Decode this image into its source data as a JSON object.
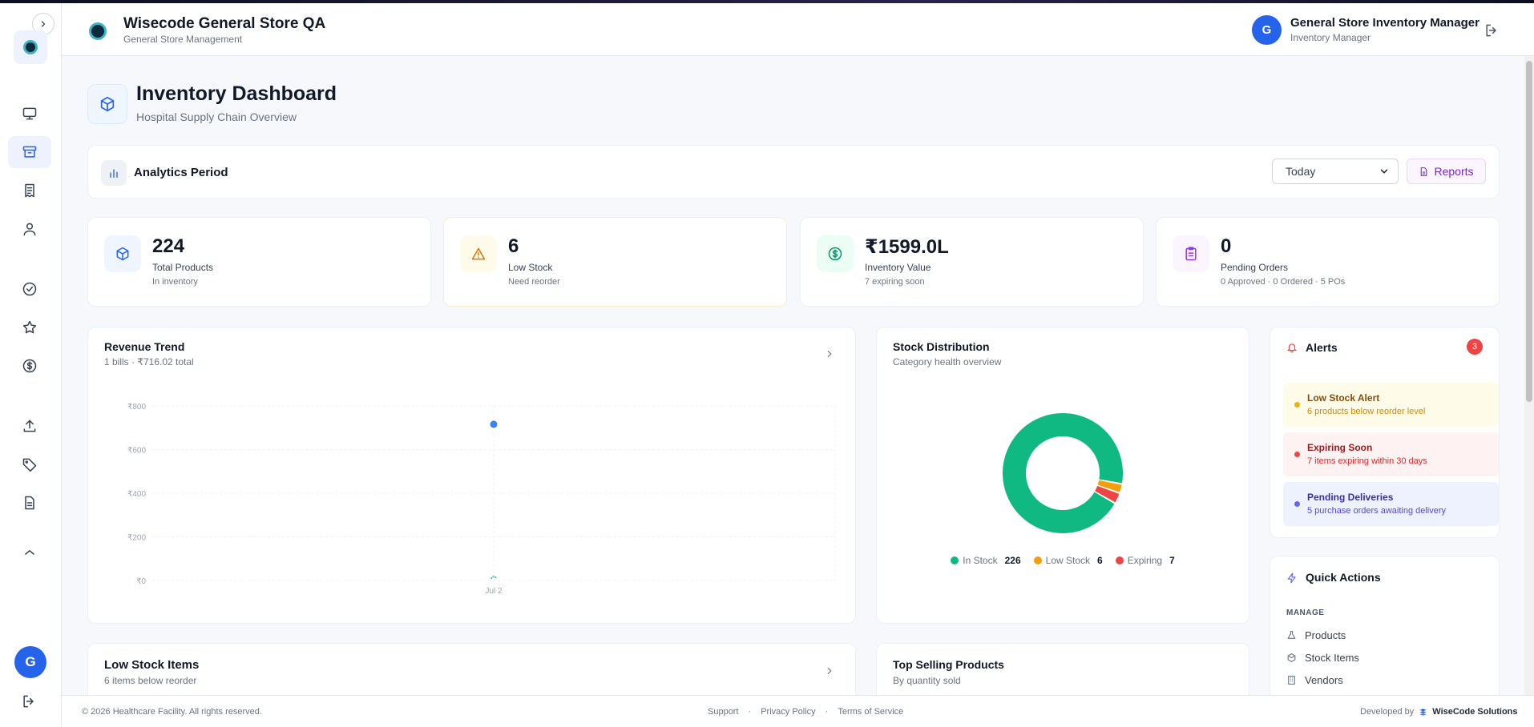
{
  "header": {
    "brand_title": "Wisecode General Store QA",
    "brand_subtitle": "General Store Management",
    "user_initial": "G",
    "user_name": "General Store Inventory Manager",
    "user_role": "Inventory Manager"
  },
  "sidebar": {
    "items": [
      {
        "icon": "monitor-icon"
      },
      {
        "icon": "archive-icon",
        "active": true
      },
      {
        "icon": "receipt-icon"
      },
      {
        "icon": "user-icon"
      },
      {
        "icon": "check-circle-icon"
      },
      {
        "icon": "star-icon"
      },
      {
        "icon": "dollar-circle-icon"
      },
      {
        "icon": "upload-icon"
      },
      {
        "icon": "tag-icon"
      },
      {
        "icon": "file-text-icon"
      },
      {
        "icon": "chevron-up-icon"
      }
    ],
    "avatar_initial": "G"
  },
  "page": {
    "title": "Inventory Dashboard",
    "subtitle": "Hospital Supply Chain Overview"
  },
  "analytics": {
    "label": "Analytics Period",
    "period": "Today",
    "reports_label": "Reports"
  },
  "stats": [
    {
      "value": "224",
      "label": "Total Products",
      "sub": "In inventory",
      "color": "#2563eb"
    },
    {
      "value": "6",
      "label": "Low Stock",
      "sub": "Need reorder",
      "color": "#d97706"
    },
    {
      "value": "₹1599.0L",
      "label": "Inventory Value",
      "sub": "7 expiring soon",
      "color": "#059669"
    },
    {
      "value": "0",
      "label": "Pending Orders",
      "sub": "0 Approved · 0 Ordered · 5 POs",
      "color": "#9333ea"
    }
  ],
  "revenue": {
    "title": "Revenue Trend",
    "subtitle": "1 bills · ₹716.02 total"
  },
  "stock_dist": {
    "title": "Stock Distribution",
    "subtitle": "Category health overview",
    "legend": [
      {
        "label": "In Stock",
        "count": "226",
        "color": "#10b981"
      },
      {
        "label": "Low Stock",
        "count": "6",
        "color": "#f59e0b"
      },
      {
        "label": "Expiring",
        "count": "7",
        "color": "#ef4444"
      }
    ]
  },
  "chart_data": [
    {
      "type": "line",
      "title": "Revenue Trend",
      "x": [
        "Jul 2"
      ],
      "series": [
        {
          "values": [
            716.02
          ]
        }
      ],
      "yticks": [
        "₹800",
        "₹600",
        "₹400",
        "₹200",
        "₹0"
      ],
      "ylim": [
        0,
        800
      ],
      "color": "#3b82f6"
    },
    {
      "type": "pie",
      "title": "Stock Distribution",
      "categories": [
        "In Stock",
        "Low Stock",
        "Expiring"
      ],
      "values": [
        226,
        6,
        7
      ],
      "colors": [
        "#10b981",
        "#f59e0b",
        "#ef4444"
      ]
    }
  ],
  "alerts": {
    "title": "Alerts",
    "count": "3",
    "items": [
      {
        "title": "Low Stock Alert",
        "sub": "6 products below reorder level",
        "bg": "#fefce8",
        "dot": "#eab308",
        "tc": "#854d0e",
        "sc": "#ca8a04"
      },
      {
        "title": "Expiring Soon",
        "sub": "7 items expiring within 30 days",
        "bg": "#fef2f2",
        "dot": "#ef4444",
        "tc": "#991b1b",
        "sc": "#dc2626"
      },
      {
        "title": "Pending Deliveries",
        "sub": "5 purchase orders awaiting delivery",
        "bg": "#eef2ff",
        "dot": "#6366f1",
        "tc": "#3730a3",
        "sc": "#4f46e5"
      }
    ]
  },
  "quick_actions": {
    "title": "Quick Actions",
    "section": "MANAGE",
    "items": [
      {
        "label": "Products",
        "icon": "flask-icon"
      },
      {
        "label": "Stock Items",
        "icon": "box-icon"
      },
      {
        "label": "Vendors",
        "icon": "building-icon"
      }
    ]
  },
  "low_stock": {
    "title": "Low Stock Items",
    "subtitle": "6 items below reorder"
  },
  "top_selling": {
    "title": "Top Selling Products",
    "subtitle": "By quantity sold"
  },
  "footer": {
    "copyright": "© 2026 Healthcare Facility. All rights reserved.",
    "links": [
      "Support",
      "Privacy Policy",
      "Terms of Service"
    ],
    "developed_by": "Developed by",
    "company": "WiseCode Solutions"
  }
}
